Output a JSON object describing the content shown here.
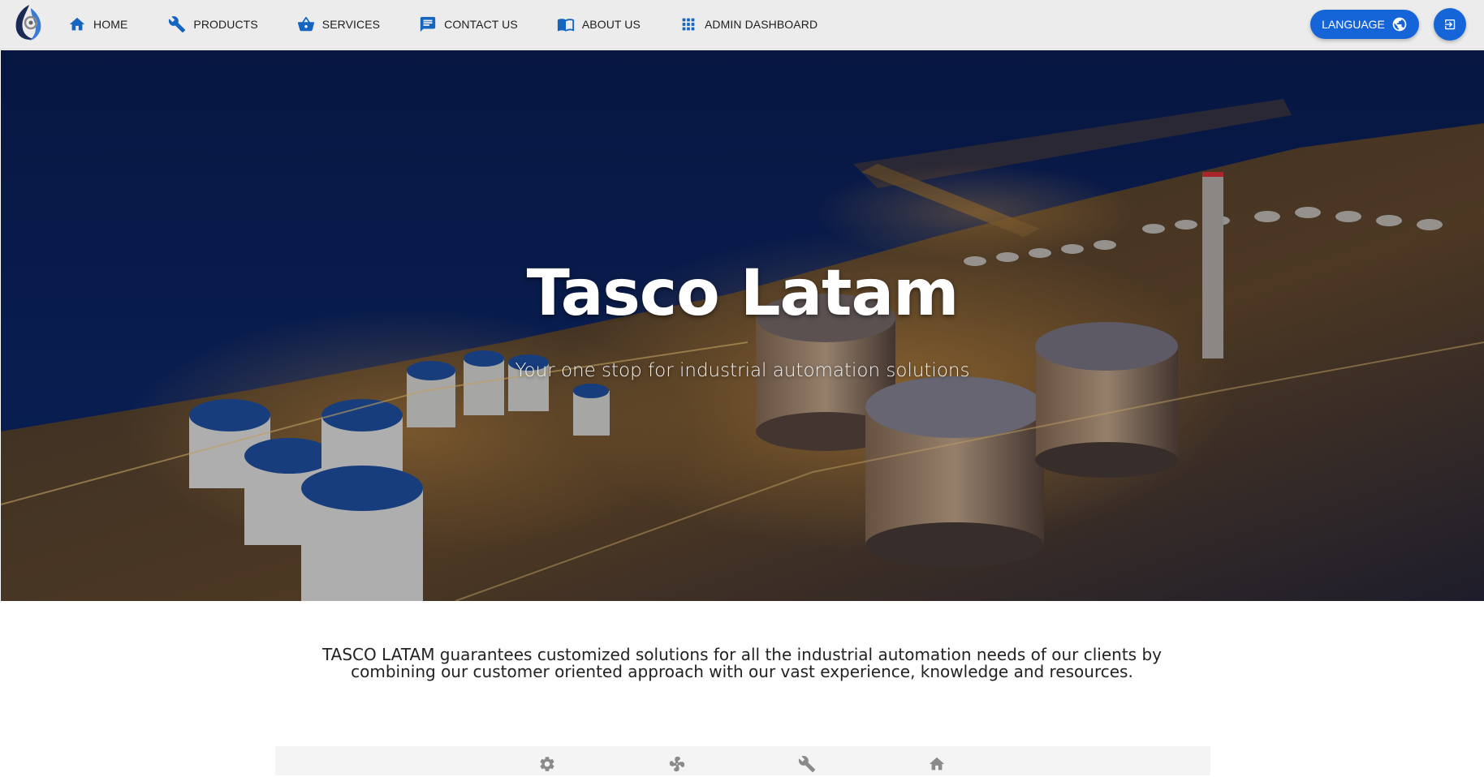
{
  "nav": {
    "items": [
      {
        "label": "HOME",
        "icon": "home-icon"
      },
      {
        "label": "PRODUCTS",
        "icon": "wrench-icon"
      },
      {
        "label": "SERVICES",
        "icon": "basket-icon"
      },
      {
        "label": "CONTACT US",
        "icon": "message-icon"
      },
      {
        "label": "ABOUT US",
        "icon": "book-icon"
      },
      {
        "label": "ADMIN DASHBOARD",
        "icon": "grid-icon"
      }
    ],
    "language_label": "LANGUAGE",
    "accent_color": "#1565d8"
  },
  "hero": {
    "title": "Tasco Latam",
    "subtitle": "Your one stop for industrial automation solutions"
  },
  "description": "TASCO LATAM guarantees customized solutions for all the industrial automation needs of our clients by combining our customer oriented approach with our vast experience, knowledge and resources.",
  "service_strip": {
    "icons": [
      "gear-icon",
      "fan-icon",
      "wrench-icon",
      "home-icon"
    ]
  }
}
